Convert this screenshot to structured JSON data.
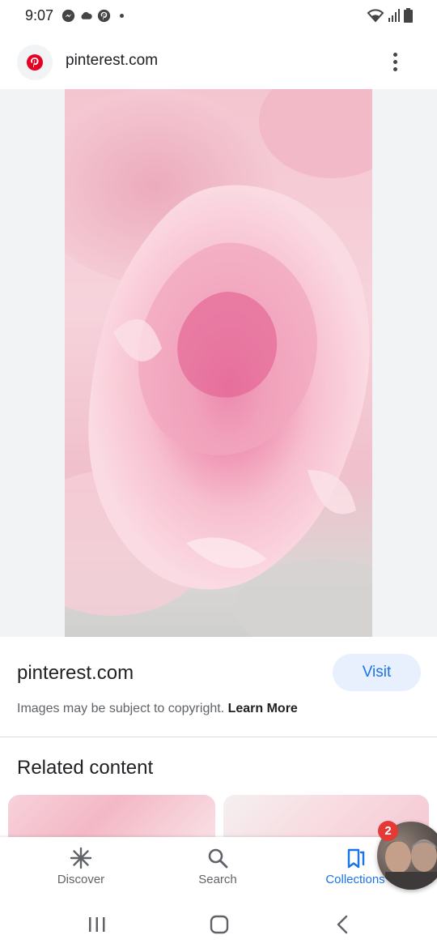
{
  "status_bar": {
    "time": "9:07",
    "left_icons": [
      "messenger-icon",
      "cloud-icon",
      "pinterest-icon"
    ],
    "right_icons": [
      "wifi-icon",
      "signal-icon",
      "battery-icon"
    ]
  },
  "header": {
    "site_icon": "pinterest-logo",
    "title": "pinterest.com",
    "menu_icon": "more-vert-icon"
  },
  "image": {
    "subject": "pink carnation"
  },
  "info": {
    "domain": "pinterest.com",
    "visit_label": "Visit",
    "copyright_text": "Images may be subject to copyright.",
    "learn_more": "Learn More"
  },
  "related": {
    "title": "Related content"
  },
  "bottom_nav": {
    "items": [
      {
        "label": "Discover",
        "icon": "discover-icon",
        "active": false
      },
      {
        "label": "Search",
        "icon": "search-icon",
        "active": false
      },
      {
        "label": "Collections",
        "icon": "collections-icon",
        "active": true
      }
    ],
    "profile_badge": "2"
  },
  "system_nav": [
    "recents-icon",
    "home-icon",
    "back-icon"
  ],
  "colors": {
    "accent": "#1a73e8",
    "visit_bg": "#e8f0fe",
    "badge": "#e53935",
    "pinterest": "#e60023",
    "image_bg": "#f1f3f4"
  }
}
